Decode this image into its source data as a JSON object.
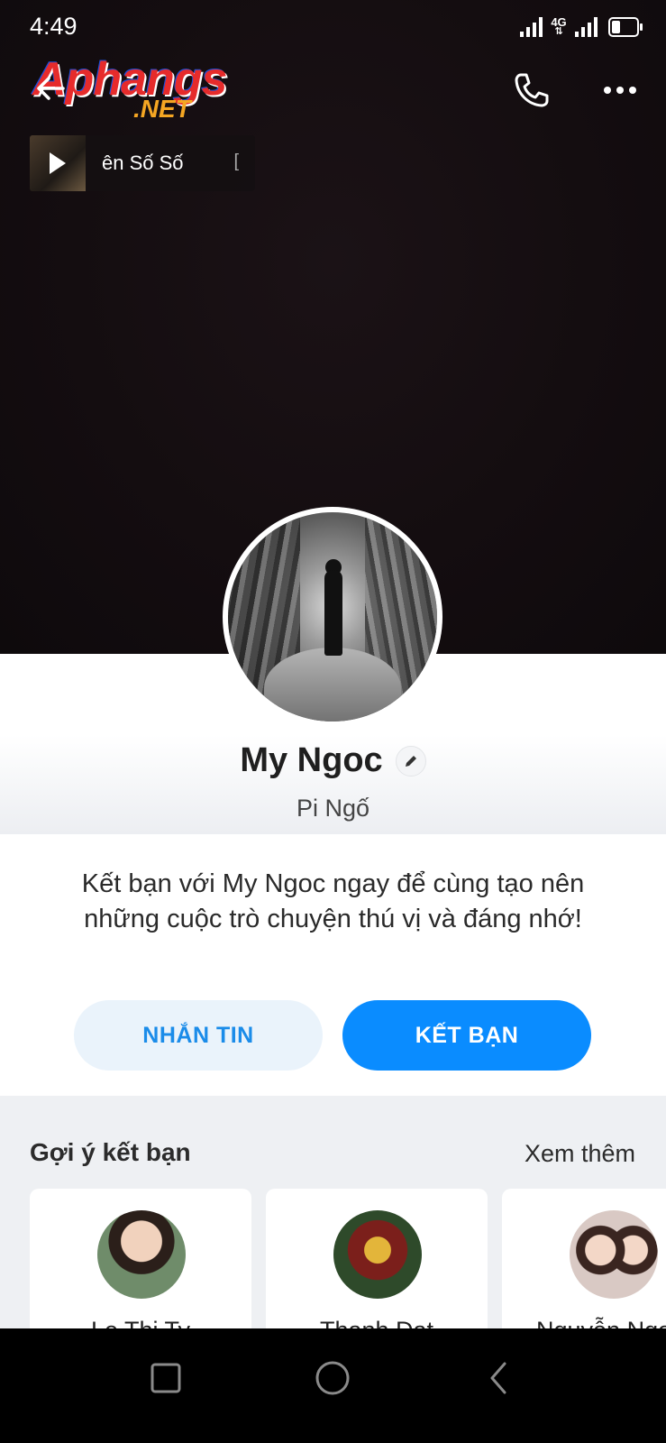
{
  "status_bar": {
    "time": "4:49",
    "network_label": "4G"
  },
  "watermark": {
    "line1": "Aphangs",
    "line2": ".NET"
  },
  "header": {
    "back_icon": "arrow-left-icon",
    "call_icon": "phone-icon",
    "more_icon": "more-horizontal-icon"
  },
  "music": {
    "title": "ên Số Số",
    "trailing": "["
  },
  "profile": {
    "name": "My Ngoc",
    "nickname": "Pi Ngố"
  },
  "friend_prompt": {
    "text": "Kết bạn với My Ngoc ngay để cùng tạo nên những cuộc trò chuyện thú vị và đáng nhớ!",
    "message_button": "NHẮN TIN",
    "add_friend_button": "KẾT BẠN"
  },
  "suggestions": {
    "title": "Gợi ý kết bạn",
    "see_more": "Xem thêm",
    "items": [
      {
        "name": "Le Thi Ty"
      },
      {
        "name": "Thanh Dat"
      },
      {
        "name": "Nguyễn Ngọ"
      }
    ]
  },
  "colors": {
    "accent": "#0A8CFF",
    "secondary_button_bg": "#EAF3FB",
    "secondary_button_text": "#1B8CE9"
  }
}
